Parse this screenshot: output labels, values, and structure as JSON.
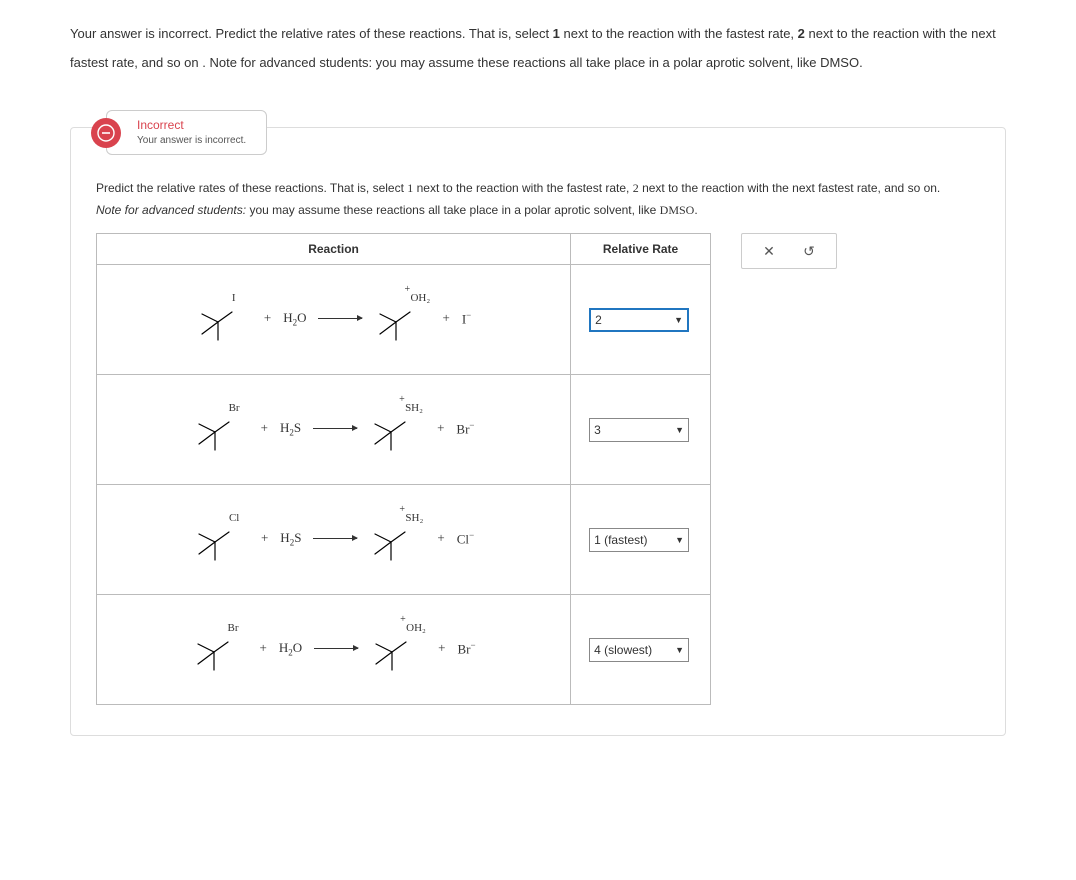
{
  "top_prefix": "Your answer is incorrect. Predict the relative rates of these reactions. That is, select ",
  "top_one": "1",
  "top_mid1": " next to the reaction with the fastest rate, ",
  "top_two": "2",
  "top_mid2": " next to the reaction with the next fastest rate, and so on .  Note for advanced students: you may assume these reactions all take place in a polar aprotic solvent, like DMSO.",
  "badge": {
    "title": "Incorrect",
    "sub": "Your answer is incorrect."
  },
  "instr": {
    "a": "Predict the relative rates of these reactions. That is, select ",
    "one": "1",
    "b": " next to the reaction with the fastest rate, ",
    "two": "2",
    "c": " next to the reaction with the next fastest rate, and so on.",
    "note_label": "Note for advanced students:",
    "note_body": " you may assume these reactions all take place in a polar aprotic solvent, like ",
    "dmso": "DMSO",
    "period": "."
  },
  "headers": {
    "reaction": "Reaction",
    "rate": "Relative Rate"
  },
  "rows": [
    {
      "start_lg": "I",
      "reagent_html": "H₂O",
      "prod_lg": "OH₂",
      "ion": "I⁻",
      "rate": "2",
      "highlight": true
    },
    {
      "start_lg": "Br",
      "reagent_html": "H₂S",
      "prod_lg": "SH₂",
      "ion": "Br⁻",
      "rate": "3",
      "highlight": false
    },
    {
      "start_lg": "Cl",
      "reagent_html": "H₂S",
      "prod_lg": "SH₂",
      "ion": "Cl⁻",
      "rate": "1 (fastest)",
      "highlight": false
    },
    {
      "start_lg": "Br",
      "reagent_html": "H₂O",
      "prod_lg": "OH₂",
      "ion": "Br⁻",
      "rate": "4 (slowest)",
      "highlight": false
    }
  ],
  "tools": {
    "close": "✕",
    "reset": "↺"
  }
}
